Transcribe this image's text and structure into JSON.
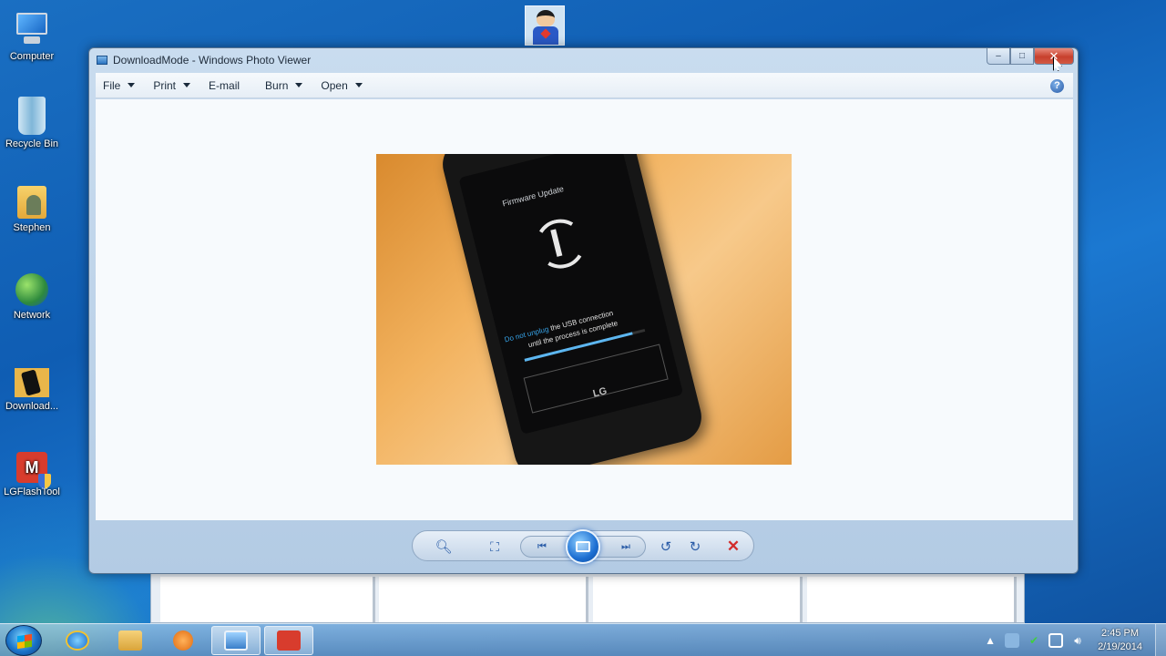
{
  "desktop": {
    "icons": [
      {
        "label": "Computer"
      },
      {
        "label": "Recycle Bin"
      },
      {
        "label": "Stephen"
      },
      {
        "label": "Network"
      },
      {
        "label": "Download..."
      },
      {
        "label": "LGFlashTool"
      }
    ]
  },
  "window": {
    "title": "DownloadMode - Windows Photo Viewer",
    "buttons": {
      "minimize": "–",
      "maximize": "□",
      "close": "✕"
    },
    "menu": [
      {
        "label": "File",
        "dropdown": true
      },
      {
        "label": "Print",
        "dropdown": true
      },
      {
        "label": "E-mail",
        "dropdown": false
      },
      {
        "label": "Burn",
        "dropdown": true
      },
      {
        "label": "Open",
        "dropdown": true
      }
    ],
    "help": "?"
  },
  "photo": {
    "screen_title": "Firmware Update",
    "message_highlight": "Do not unplug",
    "message_rest": "the USB connection",
    "message_line2": "until the process is complete",
    "brand": "LG"
  },
  "controls": {
    "zoom_icon": "magnifier-icon",
    "fit_icon": "actual-size-icon",
    "previous_icon": "previous-icon",
    "slideshow_icon": "slideshow-icon",
    "next_icon": "next-icon",
    "rotate_ccw_icon": "rotate-counterclockwise-icon",
    "rotate_cw_icon": "rotate-clockwise-icon",
    "delete_icon": "delete-icon"
  },
  "taskbar": {
    "clock_time": "2:45 PM",
    "clock_date": "2/19/2014"
  }
}
